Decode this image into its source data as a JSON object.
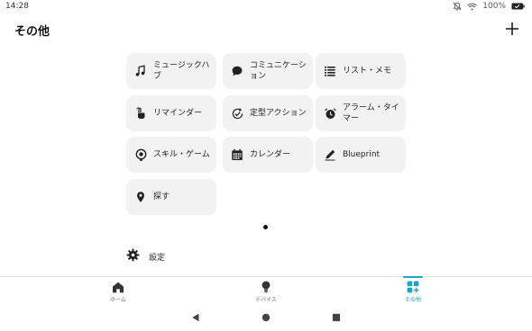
{
  "status_bar": {
    "time": "14:28",
    "battery": "100%",
    "icons": [
      "notifications-off-icon",
      "wifi-icon",
      "battery-icon"
    ]
  },
  "header": {
    "title": "その他",
    "add_icon": "plus-icon"
  },
  "tiles": [
    {
      "label": "ミュージックハブ",
      "icon": "music-note-icon"
    },
    {
      "label": "コミュニケーション",
      "icon": "speech-bubble-icon"
    },
    {
      "label": "リスト・メモ",
      "icon": "list-icon"
    },
    {
      "label": "リマインダー",
      "icon": "tap-hand-icon"
    },
    {
      "label": "定型アクション",
      "icon": "routine-check-icon"
    },
    {
      "label": "アラーム・タイマー",
      "icon": "alarm-clock-icon"
    },
    {
      "label": "スキル・ゲーム",
      "icon": "skill-bulb-icon"
    },
    {
      "label": "カレンダー",
      "icon": "calendar-icon"
    },
    {
      "label": "Blueprint",
      "icon": "pen-icon"
    },
    {
      "label": "探す",
      "icon": "location-pin-icon"
    }
  ],
  "settings": {
    "label": "設定",
    "icon": "gear-icon"
  },
  "bottom_nav": {
    "items": [
      {
        "label": "ホーム",
        "icon": "home-icon",
        "active": false
      },
      {
        "label": "デバイス",
        "icon": "lightbulb-icon",
        "active": false
      },
      {
        "label": "その他",
        "icon": "grid-plus-icon",
        "active": true
      }
    ],
    "accent_color": "#1aa4c8"
  },
  "system_nav": [
    "back-triangle-icon",
    "home-circle-icon",
    "recents-square-icon"
  ],
  "colors": {
    "tile_background": "#f2f2f2",
    "text": "#222222",
    "accent": "#1aa4c8"
  }
}
